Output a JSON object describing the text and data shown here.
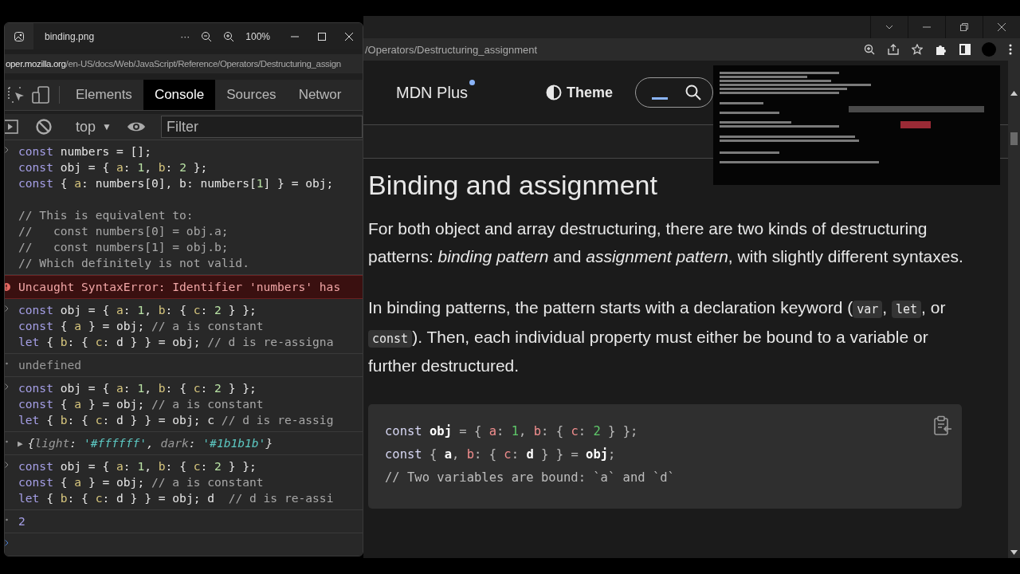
{
  "viewer": {
    "title": "binding.png",
    "more": "···",
    "zoom": "100%",
    "url": {
      "host": "oper.mozilla.org",
      "path": "/en-US/docs/Web/JavaScript/Reference/Operators/Destructuring_assign"
    },
    "devtools": {
      "tabs": [
        {
          "label": "Elements",
          "selected": false
        },
        {
          "label": "Console",
          "selected": true
        },
        {
          "label": "Sources",
          "selected": false
        },
        {
          "label": "Networ",
          "selected": false
        }
      ],
      "context": "top",
      "context_caret": "▼",
      "filter": {
        "placeholder": "Filter"
      },
      "console": [
        {
          "kind": "input",
          "lines": [
            {
              "tokens": [
                {
                  "kind": "kw",
                  "text": "const"
                },
                {
                  "kind": "id",
                  "text": " numbers = [];"
                }
              ]
            },
            {
              "tokens": [
                {
                  "kind": "kw",
                  "text": "const"
                },
                {
                  "kind": "id",
                  "text": " obj = { "
                },
                {
                  "kind": "prop",
                  "text": "a"
                },
                {
                  "kind": "id",
                  "text": ": "
                },
                {
                  "kind": "num",
                  "text": "1"
                },
                {
                  "kind": "id",
                  "text": ", "
                },
                {
                  "kind": "prop",
                  "text": "b"
                },
                {
                  "kind": "id",
                  "text": ": "
                },
                {
                  "kind": "num",
                  "text": "2"
                },
                {
                  "kind": "id",
                  "text": " };"
                }
              ]
            },
            {
              "tokens": [
                {
                  "kind": "kw",
                  "text": "const"
                },
                {
                  "kind": "id",
                  "text": " { "
                },
                {
                  "kind": "prop",
                  "text": "a"
                },
                {
                  "kind": "id",
                  "text": ": numbers[0], b: numbers["
                },
                {
                  "kind": "num",
                  "text": "1"
                },
                {
                  "kind": "id",
                  "text": "] } = obj;"
                }
              ]
            },
            {
              "tokens": [
                {
                  "kind": "com",
                  "text": "// This is equivalent to:"
                }
              ],
              "spaced": true
            },
            {
              "tokens": [
                {
                  "kind": "com",
                  "text": "//   const numbers[0] = obj.a;"
                }
              ]
            },
            {
              "tokens": [
                {
                  "kind": "com",
                  "text": "//   const numbers[1] = obj.b;"
                }
              ]
            },
            {
              "tokens": [
                {
                  "kind": "com",
                  "text": "// Which definitely is not valid."
                }
              ]
            }
          ]
        },
        {
          "kind": "error",
          "text": "Uncaught SyntaxError: Identifier 'numbers' has"
        },
        {
          "kind": "input",
          "lines": [
            {
              "tokens": [
                {
                  "kind": "kw",
                  "text": "const"
                },
                {
                  "kind": "id",
                  "text": " obj = { "
                },
                {
                  "kind": "prop",
                  "text": "a"
                },
                {
                  "kind": "id",
                  "text": ": "
                },
                {
                  "kind": "num",
                  "text": "1"
                },
                {
                  "kind": "id",
                  "text": ", "
                },
                {
                  "kind": "prop",
                  "text": "b"
                },
                {
                  "kind": "id",
                  "text": ": { "
                },
                {
                  "kind": "prop",
                  "text": "c"
                },
                {
                  "kind": "id",
                  "text": ": "
                },
                {
                  "kind": "num",
                  "text": "2"
                },
                {
                  "kind": "id",
                  "text": " } };"
                }
              ]
            },
            {
              "tokens": [
                {
                  "kind": "kw",
                  "text": "const"
                },
                {
                  "kind": "id",
                  "text": " { "
                },
                {
                  "kind": "prop",
                  "text": "a"
                },
                {
                  "kind": "id",
                  "text": " } = obj; "
                },
                {
                  "kind": "com",
                  "text": "// a is constant"
                }
              ]
            },
            {
              "tokens": [
                {
                  "kind": "kw",
                  "text": "let"
                },
                {
                  "kind": "id",
                  "text": " { "
                },
                {
                  "kind": "prop",
                  "text": "b"
                },
                {
                  "kind": "id",
                  "text": ": { "
                },
                {
                  "kind": "prop",
                  "text": "c"
                },
                {
                  "kind": "id",
                  "text": ": d } } = obj; "
                },
                {
                  "kind": "com",
                  "text": "// d is re-assigna"
                }
              ]
            }
          ]
        },
        {
          "kind": "result",
          "tokens": [
            {
              "kind": "punc",
              "text": "undefined"
            }
          ]
        },
        {
          "kind": "input",
          "lines": [
            {
              "tokens": [
                {
                  "kind": "kw",
                  "text": "const"
                },
                {
                  "kind": "id",
                  "text": " obj = { "
                },
                {
                  "kind": "prop",
                  "text": "a"
                },
                {
                  "kind": "id",
                  "text": ": "
                },
                {
                  "kind": "num",
                  "text": "1"
                },
                {
                  "kind": "id",
                  "text": ", "
                },
                {
                  "kind": "prop",
                  "text": "b"
                },
                {
                  "kind": "id",
                  "text": ": { "
                },
                {
                  "kind": "prop",
                  "text": "c"
                },
                {
                  "kind": "id",
                  "text": ": "
                },
                {
                  "kind": "num",
                  "text": "2"
                },
                {
                  "kind": "id",
                  "text": " } };"
                }
              ]
            },
            {
              "tokens": [
                {
                  "kind": "kw",
                  "text": "const"
                },
                {
                  "kind": "id",
                  "text": " { "
                },
                {
                  "kind": "prop",
                  "text": "a"
                },
                {
                  "kind": "id",
                  "text": " } = obj; "
                },
                {
                  "kind": "com",
                  "text": "// a is constant"
                }
              ]
            },
            {
              "tokens": [
                {
                  "kind": "kw",
                  "text": "let"
                },
                {
                  "kind": "id",
                  "text": " { "
                },
                {
                  "kind": "prop",
                  "text": "b"
                },
                {
                  "kind": "id",
                  "text": ": { "
                },
                {
                  "kind": "prop",
                  "text": "c"
                },
                {
                  "kind": "id",
                  "text": ": d } } = obj; c "
                },
                {
                  "kind": "com",
                  "text": "// d is re-assig"
                }
              ]
            }
          ]
        },
        {
          "kind": "result",
          "expander": "▶",
          "tokens": [
            {
              "kind": "brace",
              "text": "{"
            },
            {
              "kind": "key",
              "text": "light"
            },
            {
              "kind": "brace",
              "text": ": "
            },
            {
              "kind": "str",
              "text": "'#ffffff'"
            },
            {
              "kind": "brace",
              "text": ", "
            },
            {
              "kind": "key",
              "text": "dark"
            },
            {
              "kind": "brace",
              "text": ": "
            },
            {
              "kind": "str",
              "text": "'#1b1b1b'"
            },
            {
              "kind": "brace",
              "text": "}"
            }
          ]
        },
        {
          "kind": "input",
          "lines": [
            {
              "tokens": [
                {
                  "kind": "kw",
                  "text": "const"
                },
                {
                  "kind": "id",
                  "text": " obj = { "
                },
                {
                  "kind": "prop",
                  "text": "a"
                },
                {
                  "kind": "id",
                  "text": ": "
                },
                {
                  "kind": "num",
                  "text": "1"
                },
                {
                  "kind": "id",
                  "text": ", "
                },
                {
                  "kind": "prop",
                  "text": "b"
                },
                {
                  "kind": "id",
                  "text": ": { "
                },
                {
                  "kind": "prop",
                  "text": "c"
                },
                {
                  "kind": "id",
                  "text": ": "
                },
                {
                  "kind": "num",
                  "text": "2"
                },
                {
                  "kind": "id",
                  "text": " } };"
                }
              ]
            },
            {
              "tokens": [
                {
                  "kind": "kw",
                  "text": "const"
                },
                {
                  "kind": "id",
                  "text": " { "
                },
                {
                  "kind": "prop",
                  "text": "a"
                },
                {
                  "kind": "id",
                  "text": " } = obj; "
                },
                {
                  "kind": "com",
                  "text": "// a is constant"
                }
              ]
            },
            {
              "tokens": [
                {
                  "kind": "kw",
                  "text": "let"
                },
                {
                  "kind": "id",
                  "text": " { "
                },
                {
                  "kind": "prop",
                  "text": "b"
                },
                {
                  "kind": "id",
                  "text": ": { "
                },
                {
                  "kind": "prop",
                  "text": "c"
                },
                {
                  "kind": "id",
                  "text": ": d } } = obj; d  "
                },
                {
                  "kind": "com",
                  "text": "// d is re-assi"
                }
              ]
            }
          ]
        },
        {
          "kind": "result",
          "tokens": [
            {
              "kind": "val",
              "text": "2"
            }
          ]
        },
        {
          "kind": "prompt"
        }
      ]
    }
  },
  "browser": {
    "url": "/Operators/Destructuring_assignment",
    "header": {
      "plus": "MDN Plus",
      "theme": "Theme"
    },
    "article": {
      "title": "Binding and assignment",
      "paragraphs": [
        [
          {
            "kind": "text",
            "text": "For both object and array destructuring, there are two kinds of destructuring patterns: *binding pattern* and *assignment pattern*, with slightly different syntaxes."
          }
        ],
        [
          {
            "kind": "text",
            "text": "In binding patterns, the pattern starts with a declaration keyword ("
          },
          {
            "kind": "code",
            "text": "var"
          },
          {
            "kind": "text",
            "text": ", "
          },
          {
            "kind": "code",
            "text": "let"
          },
          {
            "kind": "text",
            "text": ", or "
          },
          {
            "kind": "code",
            "text": "const"
          },
          {
            "kind": "text",
            "text": "). Then, each individual property must either be bound to a variable or further destructured."
          }
        ]
      ],
      "code_block": {
        "lines": [
          [
            {
              "kind": "kw",
              "text": "const"
            },
            {
              "kind": "id",
              "text": " obj"
            },
            {
              "kind": "punc",
              "text": " = { "
            },
            {
              "kind": "prop",
              "text": "a"
            },
            {
              "kind": "punc",
              "text": ": "
            },
            {
              "kind": "num",
              "text": "1"
            },
            {
              "kind": "punc",
              "text": ", "
            },
            {
              "kind": "prop",
              "text": "b"
            },
            {
              "kind": "punc",
              "text": ": { "
            },
            {
              "kind": "prop",
              "text": "c"
            },
            {
              "kind": "punc",
              "text": ": "
            },
            {
              "kind": "num",
              "text": "2"
            },
            {
              "kind": "punc",
              "text": " } };"
            }
          ],
          [
            {
              "kind": "kw",
              "text": "const"
            },
            {
              "kind": "punc",
              "text": " { "
            },
            {
              "kind": "id",
              "text": "a"
            },
            {
              "kind": "punc",
              "text": ", "
            },
            {
              "kind": "prop",
              "text": "b"
            },
            {
              "kind": "punc",
              "text": ": { "
            },
            {
              "kind": "prop",
              "text": "c"
            },
            {
              "kind": "punc",
              "text": ": "
            },
            {
              "kind": "id",
              "text": "d"
            },
            {
              "kind": "punc",
              "text": " } } = "
            },
            {
              "kind": "id",
              "text": "obj"
            },
            {
              "kind": "punc",
              "text": ";"
            }
          ],
          [
            {
              "kind": "com",
              "text": "// Two variables are bound: `a` and `d`"
            }
          ]
        ]
      }
    }
  }
}
